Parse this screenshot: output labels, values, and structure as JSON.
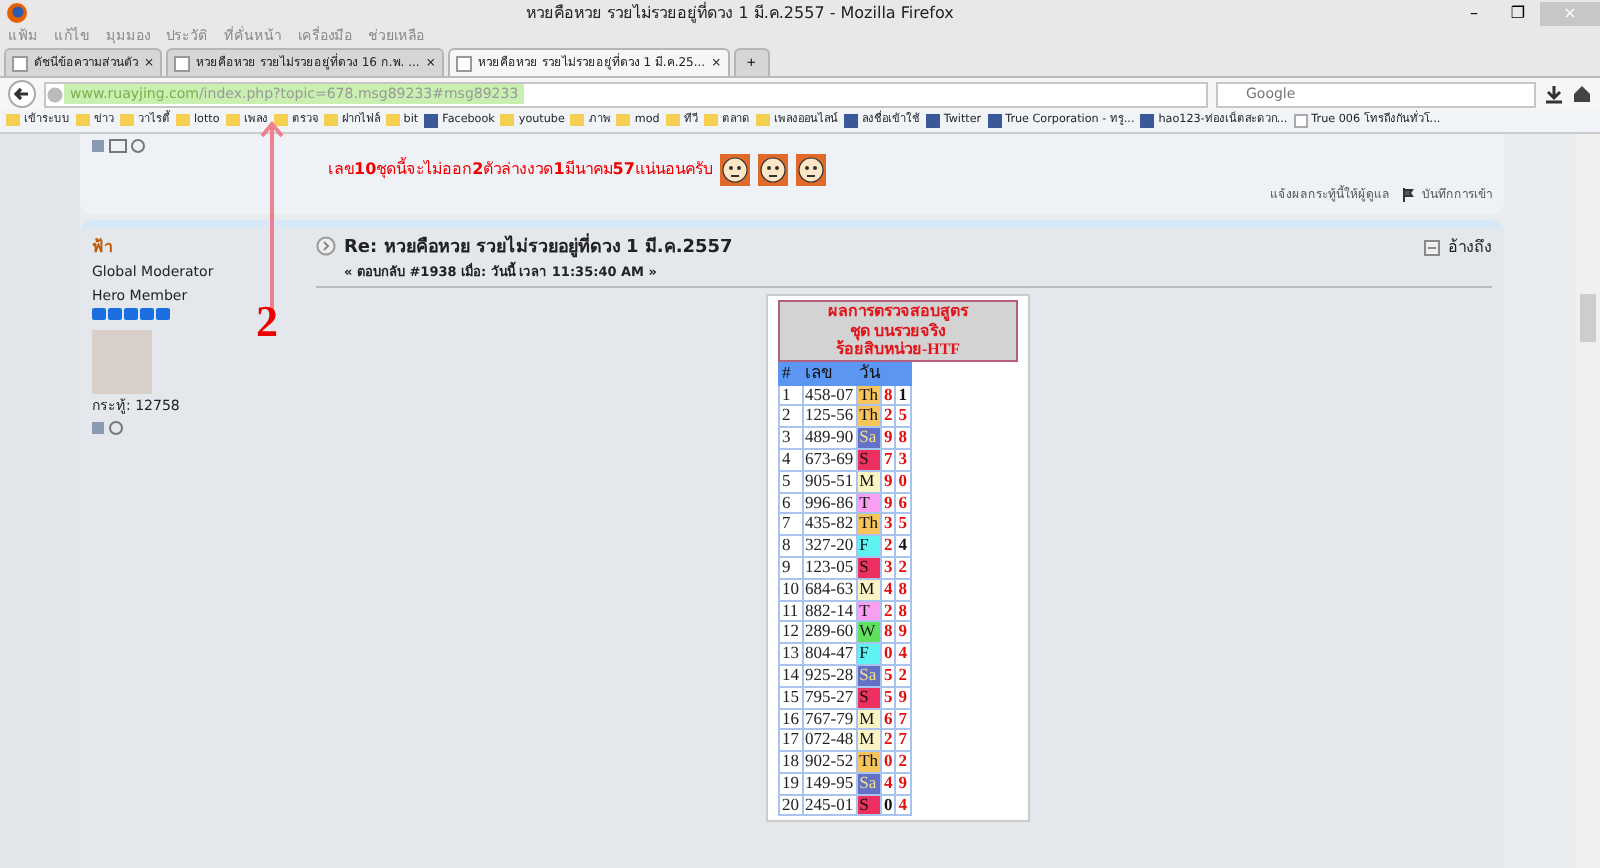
{
  "window": {
    "title": "หวยคือหวย รวยไม่รวยอยู่ที่ดวง 1 มี.ค.2557 - Mozilla Firefox",
    "controls": [
      "–",
      "❐",
      "×"
    ]
  },
  "menu": [
    "แฟ้ม",
    "แก้ไข",
    "มุมมอง",
    "ประวัติ",
    "ที่คั่นหน้า",
    "เครื่องมือ",
    "ช่วยเหลือ"
  ],
  "tabs": [
    {
      "label": "ดัชนีข้อความส่วนตัว",
      "selected": false,
      "close": "×"
    },
    {
      "label": "หวยคือหวย รวยไม่รวยอยู่ที่ดวง 16 ก.พ. ...",
      "selected": false,
      "close": "×"
    },
    {
      "label": "หวยคือหวย รวยไม่รวยอยู่ที่ดวง 1 มี.ค.25...",
      "selected": true,
      "close": "×"
    }
  ],
  "new_tab": "+",
  "address": {
    "host": "www.ruayjing.com",
    "path": "/index.php?topic=678.msg89233#msg89233"
  },
  "search": {
    "placeholder": "Google"
  },
  "bookmarks": [
    {
      "label": "เข้าระบบ",
      "kind": "folder"
    },
    {
      "label": "ข่าว",
      "kind": "folder"
    },
    {
      "label": "วาไรตี้",
      "kind": "folder"
    },
    {
      "label": "lotto",
      "kind": "folder"
    },
    {
      "label": "เพลง",
      "kind": "folder"
    },
    {
      "label": "ตรวจ",
      "kind": "folder"
    },
    {
      "label": "ฝากไฟล์",
      "kind": "folder"
    },
    {
      "label": "bit",
      "kind": "folder"
    },
    {
      "label": "Facebook",
      "kind": "site"
    },
    {
      "label": "youtube",
      "kind": "folder"
    },
    {
      "label": "ภาพ",
      "kind": "folder"
    },
    {
      "label": "mod",
      "kind": "folder"
    },
    {
      "label": "ทีวี",
      "kind": "folder"
    },
    {
      "label": "ตลาด",
      "kind": "folder"
    },
    {
      "label": "เพลงออนไลน์",
      "kind": "folder"
    },
    {
      "label": "ลงชื่อเข้าใช้",
      "kind": "site"
    },
    {
      "label": "Twitter",
      "kind": "site"
    },
    {
      "label": "True Corporation - ทรู...",
      "kind": "site"
    },
    {
      "label": "hao123-ท่องเน็ตสะดวก...",
      "kind": "site"
    },
    {
      "label": "True 006 โทรถึงกันทั่วโ...",
      "kind": "page"
    }
  ],
  "previous_post": {
    "message": "เลข**10**ชุดนี้จะไม่ออก**2**ตัวล่างงวด**1**มีนาคม**57**แน่นอนครับ",
    "report": "แจ้งผลกระทู้นี้ให้ผู้ดูแล",
    "log": "บันทึกการเข้า"
  },
  "annotation": {
    "text": "2"
  },
  "post": {
    "author": "ฟ้า",
    "group": "Global Moderator",
    "rank": "Hero Member",
    "stars": 5,
    "post_count": "กระทู้: 12758",
    "title": "Re: หวยคือหวย รวยไม่รวยอยู่ที่ดวง 1 มี.ค.2557",
    "meta": "« ตอบกลับ #1938 เมื่อ: วันนี้ เวลา 11:35:40 AM »",
    "quote": "อ้างถึง"
  },
  "result_table": {
    "heading": [
      "ผลการตรวจสอบสูตร",
      "ชุด บนรวยจริง",
      "ร้อยสิบหน่วย-HTF"
    ],
    "columns": [
      "#",
      "เลข",
      "วัน"
    ],
    "rows": [
      {
        "n": "1",
        "number": "458-07",
        "day": "Th",
        "color": "#f8c55c",
        "digits": [
          {
            "text": "8",
            "red": true
          },
          {
            "text": "1",
            "red": false
          }
        ]
      },
      {
        "n": "2",
        "number": "125-56",
        "day": "Th",
        "color": "#f8c55c",
        "digits": [
          {
            "text": "2",
            "red": true
          },
          {
            "text": "5",
            "red": true
          }
        ]
      },
      {
        "n": "3",
        "number": "489-90",
        "day": "Sa",
        "color": "#6270c6",
        "digits": [
          {
            "text": "9",
            "red": true
          },
          {
            "text": "8",
            "red": true
          }
        ]
      },
      {
        "n": "4",
        "number": "673-69",
        "day": "S",
        "color": "#ee3060",
        "digits": [
          {
            "text": "7",
            "red": true
          },
          {
            "text": "3",
            "red": true
          }
        ]
      },
      {
        "n": "5",
        "number": "905-51",
        "day": "M",
        "color": "#fcf4c4",
        "digits": [
          {
            "text": "9",
            "red": true
          },
          {
            "text": "0",
            "red": true
          }
        ]
      },
      {
        "n": "6",
        "number": "996-86",
        "day": "T",
        "color": "#f99ff2",
        "digits": [
          {
            "text": "9",
            "red": true
          },
          {
            "text": "6",
            "red": true
          }
        ]
      },
      {
        "n": "7",
        "number": "435-82",
        "day": "Th",
        "color": "#f8c55c",
        "digits": [
          {
            "text": "3",
            "red": true
          },
          {
            "text": "5",
            "red": true
          }
        ]
      },
      {
        "n": "8",
        "number": "327-20",
        "day": "F",
        "color": "#5ff2f2",
        "digits": [
          {
            "text": "2",
            "red": true
          },
          {
            "text": "4",
            "red": false
          }
        ]
      },
      {
        "n": "9",
        "number": "123-05",
        "day": "S",
        "color": "#ee3060",
        "digits": [
          {
            "text": "3",
            "red": true
          },
          {
            "text": "2",
            "red": true
          }
        ]
      },
      {
        "n": "10",
        "number": "684-63",
        "day": "M",
        "color": "#fcf4c4",
        "digits": [
          {
            "text": "4",
            "red": true
          },
          {
            "text": "8",
            "red": true
          }
        ]
      },
      {
        "n": "11",
        "number": "882-14",
        "day": "T",
        "color": "#f99ff2",
        "digits": [
          {
            "text": "2",
            "red": true
          },
          {
            "text": "8",
            "red": true
          }
        ]
      },
      {
        "n": "12",
        "number": "289-60",
        "day": "W",
        "color": "#5ee25e",
        "digits": [
          {
            "text": "8",
            "red": true
          },
          {
            "text": "9",
            "red": true
          }
        ]
      },
      {
        "n": "13",
        "number": "804-47",
        "day": "F",
        "color": "#5ff2f2",
        "digits": [
          {
            "text": "0",
            "red": true
          },
          {
            "text": "4",
            "red": true
          }
        ]
      },
      {
        "n": "14",
        "number": "925-28",
        "day": "Sa",
        "color": "#6270c6",
        "digits": [
          {
            "text": "5",
            "red": true
          },
          {
            "text": "2",
            "red": true
          }
        ]
      },
      {
        "n": "15",
        "number": "795-27",
        "day": "S",
        "color": "#ee3060",
        "digits": [
          {
            "text": "5",
            "red": true
          },
          {
            "text": "9",
            "red": true
          }
        ]
      },
      {
        "n": "16",
        "number": "767-79",
        "day": "M",
        "color": "#fcf4c4",
        "digits": [
          {
            "text": "6",
            "red": true
          },
          {
            "text": "7",
            "red": true
          }
        ]
      },
      {
        "n": "17",
        "number": "072-48",
        "day": "M",
        "color": "#fcf4c4",
        "digits": [
          {
            "text": "2",
            "red": true
          },
          {
            "text": "7",
            "red": true
          }
        ]
      },
      {
        "n": "18",
        "number": "902-52",
        "day": "Th",
        "color": "#f8c55c",
        "digits": [
          {
            "text": "0",
            "red": true
          },
          {
            "text": "2",
            "red": true
          }
        ]
      },
      {
        "n": "19",
        "number": "149-95",
        "day": "Sa",
        "color": "#6270c6",
        "digits": [
          {
            "text": "4",
            "red": true
          },
          {
            "text": "9",
            "red": true
          }
        ]
      },
      {
        "n": "20",
        "number": "245-01",
        "day": "S",
        "color": "#ee3060",
        "digits": [
          {
            "text": "0",
            "red": false
          },
          {
            "text": "4",
            "red": true
          }
        ]
      }
    ]
  }
}
